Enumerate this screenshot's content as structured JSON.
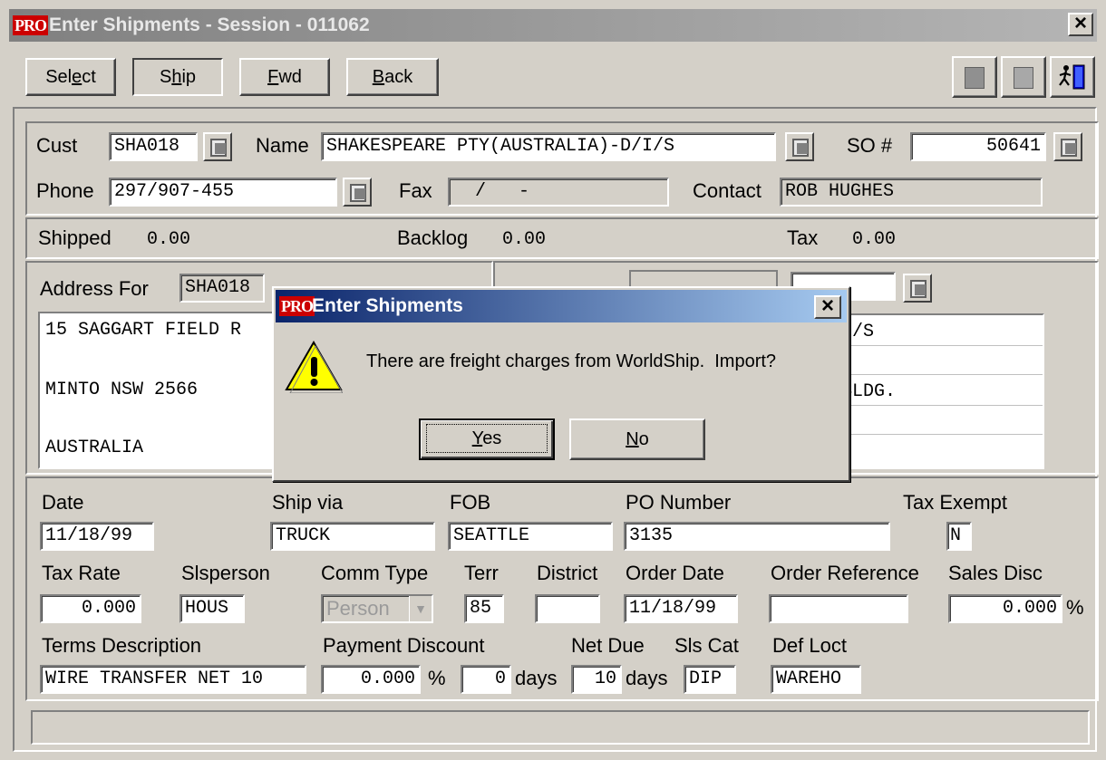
{
  "window": {
    "title": "Enter Shipments - Session - 011062",
    "close": "×"
  },
  "toolbar": {
    "buttons": [
      {
        "pre": "Sel",
        "key": "e",
        "post": "ct"
      },
      {
        "pre": "S",
        "key": "h",
        "post": "ip"
      },
      {
        "pre": "",
        "key": "F",
        "post": "wd"
      },
      {
        "pre": "",
        "key": "B",
        "post": "ack"
      }
    ]
  },
  "header": {
    "cust_label": "Cust",
    "cust_value": "SHA018",
    "name_label": "Name",
    "name_value": "SHAKESPEARE PTY(AUSTRALIA)-D/I/S",
    "so_label": "SO #",
    "so_value": "50641",
    "phone_label": "Phone",
    "phone_value": "297/907-455",
    "fax_label": "Fax",
    "fax_value": "  /   -",
    "contact_label": "Contact",
    "contact_value": "ROB HUGHES"
  },
  "totals": {
    "shipped_label": "Shipped",
    "shipped_value": "0.00",
    "backlog_label": "Backlog",
    "backlog_value": "0.00",
    "tax_label": "Tax",
    "tax_value": "0.00"
  },
  "address": {
    "label": "Address For",
    "code": "SHA018",
    "lines": [
      "15 SAGGART FIELD R",
      "",
      "MINTO NSW 2566",
      "",
      "AUSTRALIA"
    ]
  },
  "shipto": {
    "lines": [
      "I/S",
      "",
      "BLDG.",
      "",
      ""
    ]
  },
  "details": {
    "date_label": "Date",
    "date_value": "11/18/99",
    "shipvia_label": "Ship via",
    "shipvia_value": "TRUCK",
    "fob_label": "FOB",
    "fob_value": "SEATTLE",
    "po_label": "PO Number",
    "po_value": "3135",
    "taxexempt_label": "Tax Exempt",
    "taxexempt_value": "N",
    "taxrate_label": "Tax Rate",
    "taxrate_value": "0.000",
    "slsperson_label": "Slsperson",
    "slsperson_value": "HOUS",
    "commtype_label": "Comm Type",
    "commtype_value": "Person",
    "terr_label": "Terr",
    "terr_value": "85",
    "district_label": "District",
    "district_value": "",
    "orderdate_label": "Order Date",
    "orderdate_value": "11/18/99",
    "orderref_label": "Order Reference",
    "orderref_value": "",
    "salesdisc_label": "Sales Disc",
    "salesdisc_value": "0.000",
    "salesdisc_unit": "%",
    "terms_label": "Terms Description",
    "terms_value": "WIRE TRANSFER NET 10",
    "paydisc_label": "Payment Discount",
    "paydisc_value": "0.000",
    "paydisc_unit": "%",
    "paydays_value": "0",
    "paydays_unit": "days",
    "netdue_label": "Net Due",
    "netdue_value": "10",
    "netdue_unit": "days",
    "slscat_label": "Sls Cat",
    "slscat_value": "DIP",
    "defloct_label": "Def Loct",
    "defloct_value": "WAREHO"
  },
  "status": {
    "text": ""
  },
  "dialog": {
    "title": "Enter Shipments",
    "close": "×",
    "message": "There are freight charges from WorldShip.  Import?",
    "yes_key": "Y",
    "yes_rest": "es",
    "no_key": "N",
    "no_rest": "o",
    "icon": "warning-icon"
  },
  "colors": {
    "face": "#d4d0c8",
    "dialog_title": "#0a246a",
    "warning": "#ffff00"
  }
}
